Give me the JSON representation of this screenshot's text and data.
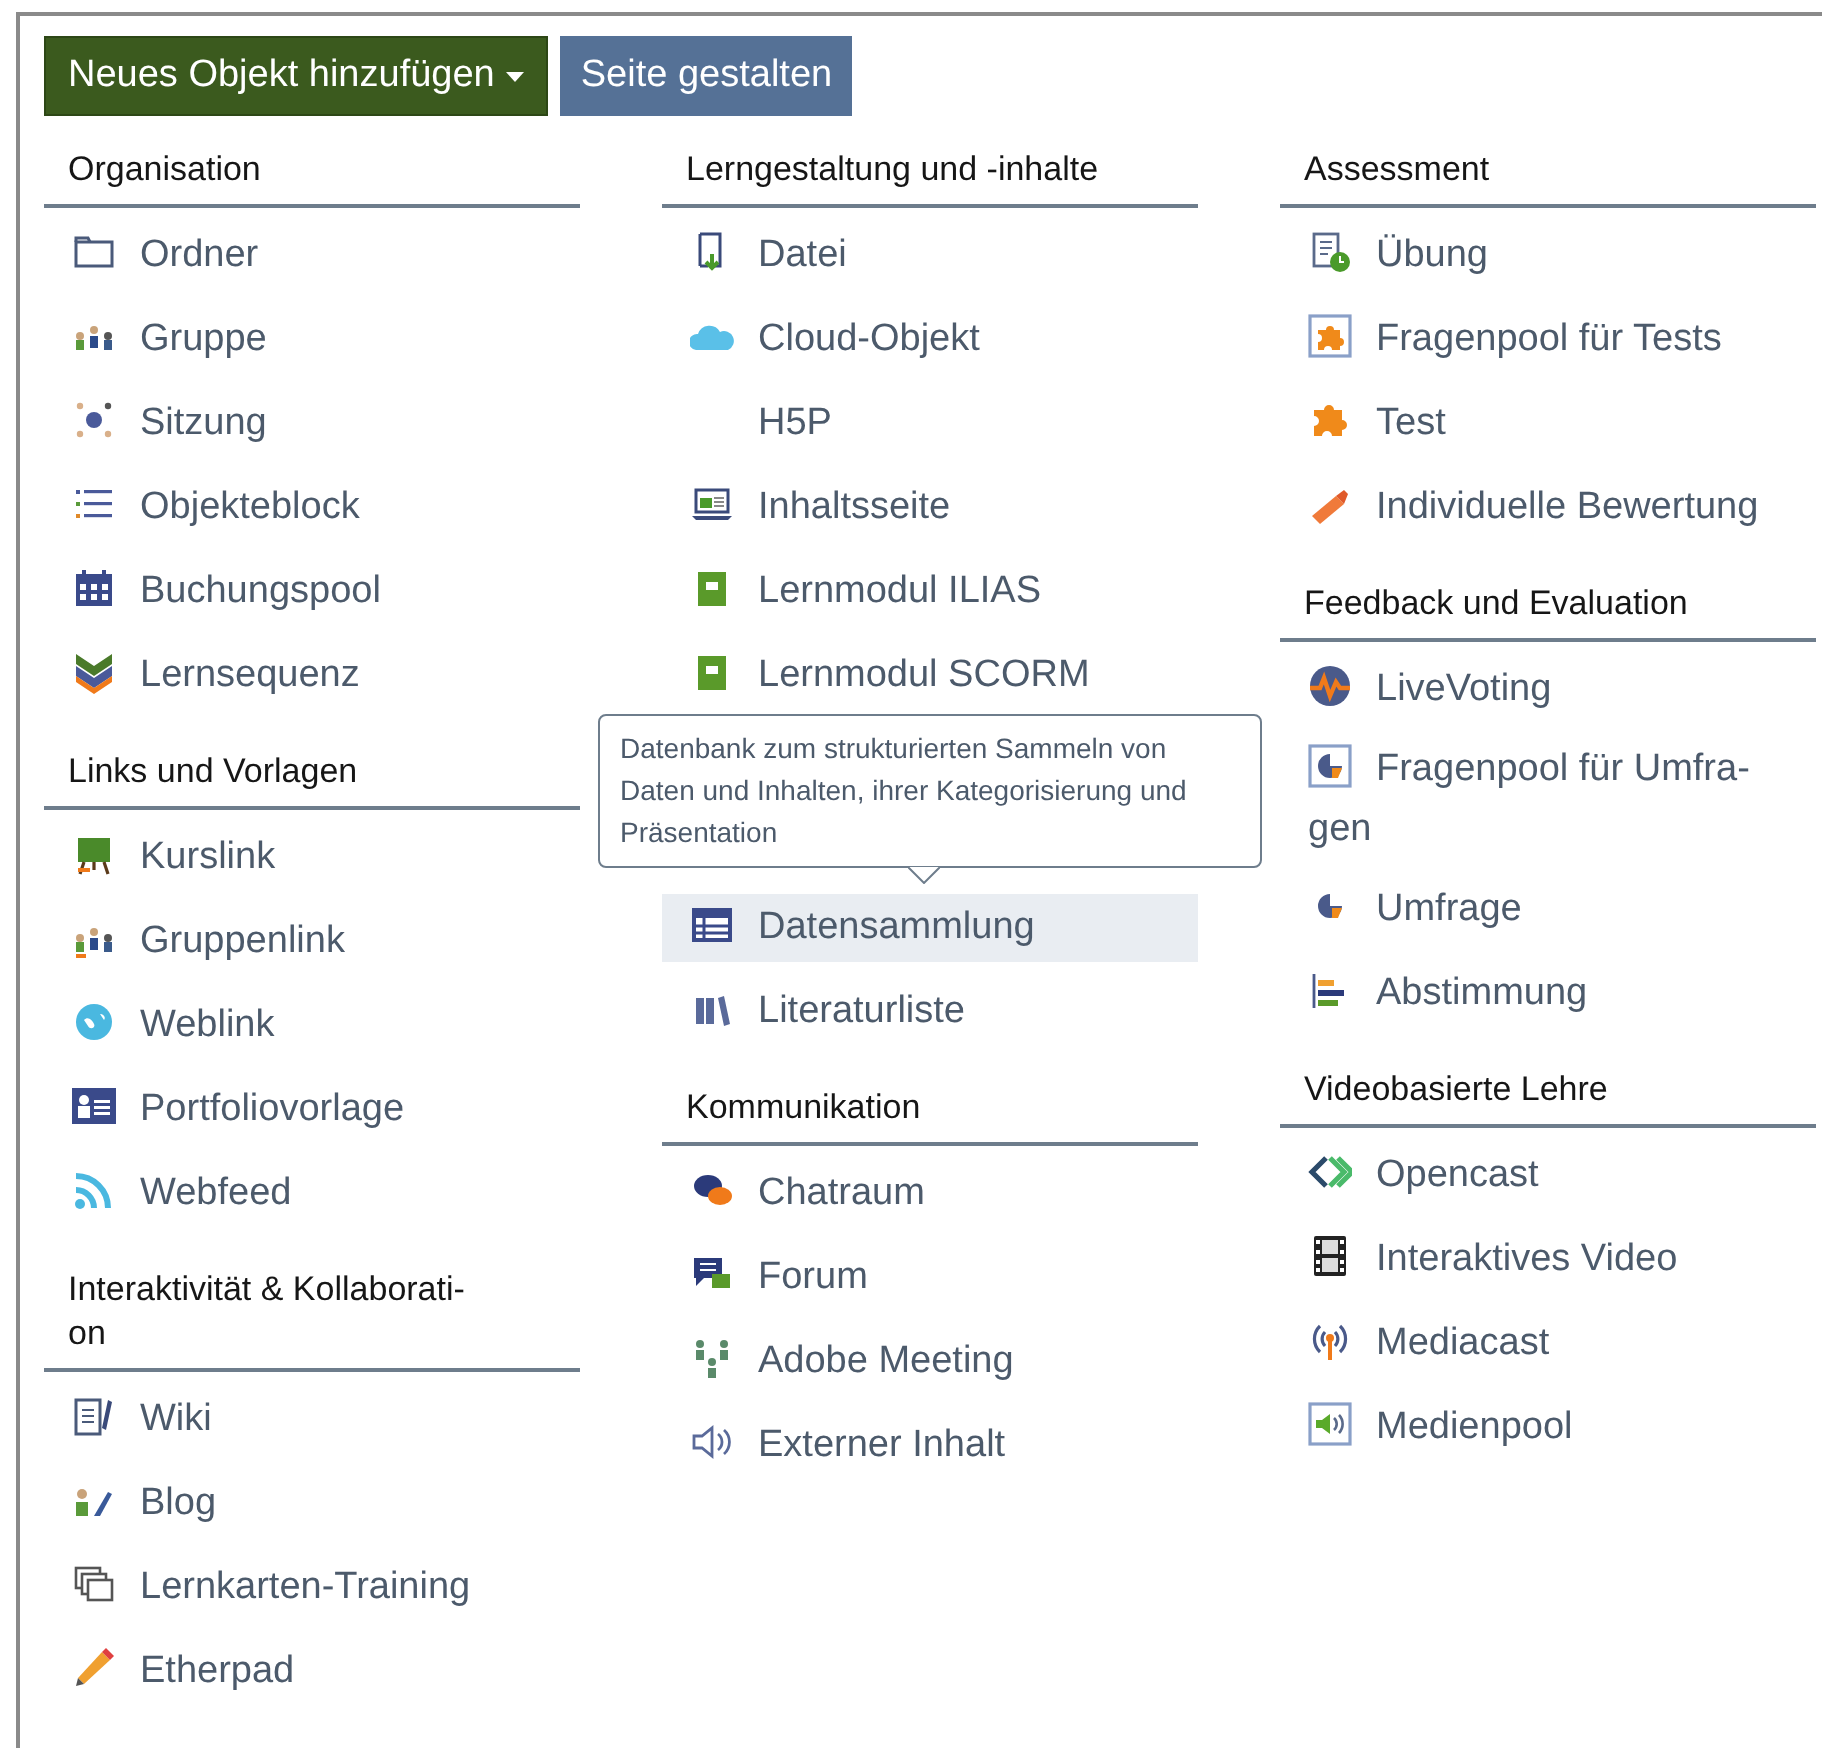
{
  "buttons": [
    {
      "label": "Neues Objekt hinzufügen",
      "kind": "dropdown"
    },
    {
      "label": "Seite gestalten",
      "kind": "plain"
    }
  ],
  "columns": [
    {
      "sections": [
        {
          "heading": "Organisation",
          "items": [
            {
              "kind": "entry",
              "label": "Ordner",
              "selected": false
            },
            {
              "kind": "entry",
              "label": "Gruppe",
              "selected": false
            },
            {
              "kind": "entry",
              "label": "Sitzung",
              "selected": false
            },
            {
              "kind": "entry",
              "label": "Objekteblock",
              "selected": false
            },
            {
              "kind": "entry",
              "label": "Buchungspool",
              "selected": false
            },
            {
              "kind": "entry",
              "label": "Lernsequenz",
              "selected": false
            }
          ]
        },
        {
          "heading": "Links und Vorlagen",
          "items": [
            {
              "kind": "entry",
              "label": "Kurslink",
              "selected": false
            },
            {
              "kind": "entry",
              "label": "Gruppenlink",
              "selected": false
            },
            {
              "kind": "entry",
              "label": "Weblink",
              "selected": false
            },
            {
              "kind": "entry",
              "label": "Portfoliovorlage",
              "selected": false
            },
            {
              "kind": "entry",
              "label": "Webfeed",
              "selected": false
            }
          ]
        },
        {
          "heading": "Interaktivität & Kollaborati-on",
          "items": [
            {
              "kind": "entry",
              "label": "Wiki",
              "selected": false
            },
            {
              "kind": "entry",
              "label": "Blog",
              "selected": false
            },
            {
              "kind": "entry",
              "label": "Lernkarten-Training",
              "selected": false
            },
            {
              "kind": "entry",
              "label": "Etherpad",
              "selected": false
            }
          ]
        }
      ]
    },
    {
      "sections": [
        {
          "heading": "Lerngestaltung und -inhalte",
          "items": [
            {
              "kind": "entry",
              "label": "Datei",
              "selected": false
            },
            {
              "kind": "entry",
              "label": "Cloud-Objekt",
              "selected": false
            },
            {
              "kind": "entry",
              "label": "H5P",
              "selected": false
            },
            {
              "kind": "entry",
              "label": "Inhaltsseite",
              "selected": false
            },
            {
              "kind": "entry",
              "label": "Lernmodul ILIAS",
              "selected": false
            },
            {
              "kind": "entry",
              "label": "Lernmodul SCORM",
              "selected": false
            },
            {
              "kind": "tooltip",
              "text": "Datenbank zum strukturierten Sammeln von Daten und Inhalten, ihrer Kategorisierung und Präsentation"
            },
            {
              "kind": "entry",
              "label": "Datensammlung",
              "selected": true
            },
            {
              "kind": "entry",
              "label": "Literaturliste",
              "selected": false
            }
          ]
        },
        {
          "heading": "Kommunikation",
          "items": [
            {
              "kind": "entry",
              "label": "Chatraum",
              "selected": false
            },
            {
              "kind": "entry",
              "label": "Forum",
              "selected": false
            },
            {
              "kind": "entry",
              "label": "Adobe Meeting",
              "selected": false
            },
            {
              "kind": "entry",
              "label": "Externer Inhalt",
              "selected": false
            }
          ]
        }
      ]
    },
    {
      "sections": [
        {
          "heading": "Assessment",
          "items": [
            {
              "kind": "entry",
              "label": "Übung",
              "selected": false
            },
            {
              "kind": "entry",
              "label": "Fragenpool für Tests",
              "selected": false
            },
            {
              "kind": "entry",
              "label": "Test",
              "selected": false
            },
            {
              "kind": "entry",
              "label": "Individuelle Bewertung",
              "selected": false
            }
          ]
        },
        {
          "heading": "Feedback und Evaluation",
          "items": [
            {
              "kind": "entry",
              "label": "LiveVoting",
              "selected": false
            },
            {
              "kind": "entry",
              "label": "Fragenpool für Umfra-gen",
              "selected": false
            },
            {
              "kind": "entry",
              "label": "Umfrage",
              "selected": false
            },
            {
              "kind": "entry",
              "label": "Abstimmung",
              "selected": false
            }
          ]
        },
        {
          "heading": "Videobasierte Lehre",
          "items": [
            {
              "kind": "entry",
              "label": "Opencast",
              "selected": false
            },
            {
              "kind": "entry",
              "label": "Interaktives Video",
              "selected": false
            },
            {
              "kind": "entry",
              "label": "Mediacast",
              "selected": false
            },
            {
              "kind": "entry",
              "label": "Medienpool",
              "selected": false
            }
          ]
        }
      ]
    }
  ]
}
